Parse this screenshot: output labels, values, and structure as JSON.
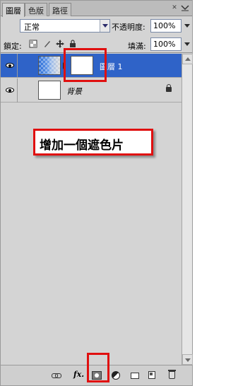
{
  "tabs": [
    {
      "label": "圖層",
      "active": true
    },
    {
      "label": "色版",
      "active": false
    },
    {
      "label": "路徑",
      "active": false
    }
  ],
  "blend": {
    "mode": "正常",
    "opacity_label": "不透明度:",
    "opacity_value": "100%"
  },
  "lock": {
    "label": "鎖定:",
    "fill_label": "填滿:",
    "fill_value": "100%"
  },
  "layers": [
    {
      "name": "圖層 1",
      "selected": true,
      "has_mask": true
    },
    {
      "name": "背景",
      "selected": false,
      "locked": true
    }
  ],
  "annotation": {
    "text": "增加一個遮色片"
  },
  "toolbar": {
    "fx_label": "fx."
  },
  "colors": {
    "selection": "#2f63c8",
    "highlight": "#e01010",
    "panel": "#d4d4d4"
  }
}
